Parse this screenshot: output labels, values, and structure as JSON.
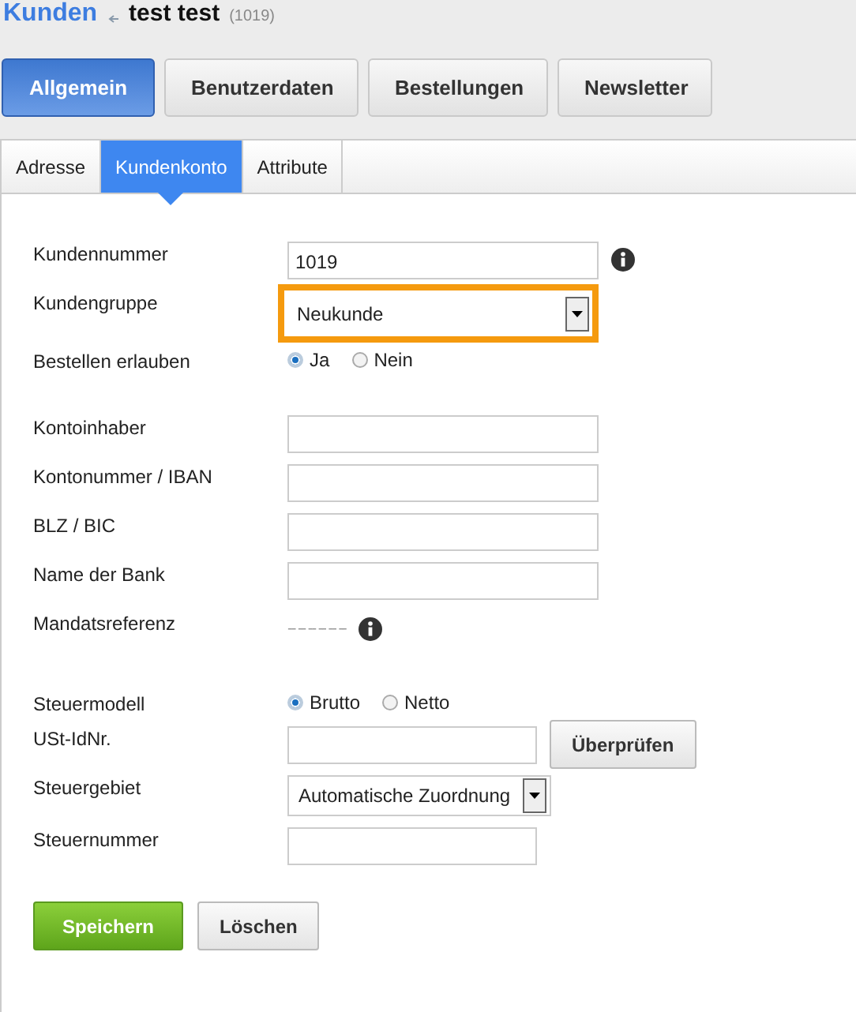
{
  "breadcrumb": {
    "parent": "Kunden",
    "title": "test test",
    "id": "(1019)"
  },
  "main_tabs": [
    {
      "label": "Allgemein",
      "selected": true
    },
    {
      "label": "Benutzerdaten",
      "selected": false
    },
    {
      "label": "Bestellungen",
      "selected": false
    },
    {
      "label": "Newsletter",
      "selected": false
    }
  ],
  "sub_tabs": [
    {
      "label": "Adresse",
      "selected": false
    },
    {
      "label": "Kundenkonto",
      "selected": true
    },
    {
      "label": "Attribute",
      "selected": false
    }
  ],
  "sections": [
    [
      {
        "label": "Kundennummer",
        "kind": "text",
        "value": "1019",
        "info": true
      },
      {
        "label": "Kundengruppe",
        "kind": "select",
        "value": "Neukunde",
        "highlighted": true
      },
      {
        "label": "Bestellen erlauben",
        "kind": "radio",
        "options": [
          {
            "label": "Ja",
            "selected": true
          },
          {
            "label": "Nein",
            "selected": false
          }
        ]
      }
    ],
    [
      {
        "label": "Kontoinhaber",
        "kind": "text"
      },
      {
        "label": "Kontonummer / IBAN",
        "kind": "text"
      },
      {
        "label": "BLZ / BIC",
        "kind": "text"
      },
      {
        "label": "Name der Bank",
        "kind": "text"
      },
      {
        "label": "Mandatsreferenz",
        "kind": "static",
        "value": "-- -- -- -- -- --",
        "info": true
      }
    ],
    [
      {
        "label": "Steuermodell",
        "kind": "radio",
        "options": [
          {
            "label": "Brutto",
            "selected": true
          },
          {
            "label": "Netto",
            "selected": false
          }
        ]
      },
      {
        "label": "USt-IdNr.",
        "kind": "text",
        "short": true,
        "button": "Überprüfen"
      },
      {
        "label": "Steuergebiet",
        "kind": "select",
        "value": "Automatische Zuordnung",
        "highlighted": false
      },
      {
        "label": "Steuernummer",
        "kind": "text",
        "short": true
      }
    ]
  ],
  "actions": [
    {
      "label": "Speichern",
      "kind": "primary"
    },
    {
      "label": "Löschen",
      "kind": "secondary"
    }
  ]
}
